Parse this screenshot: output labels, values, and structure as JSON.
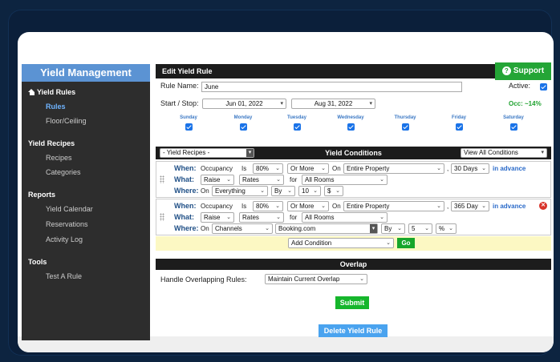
{
  "sidebar": {
    "title": "Yield Management",
    "sections": [
      {
        "title": "Yield Rules",
        "items": [
          {
            "label": "Rules",
            "active": true
          },
          {
            "label": "Floor/Ceiling"
          }
        ]
      },
      {
        "title": "Yield Recipes",
        "items": [
          {
            "label": "Recipes"
          },
          {
            "label": "Categories"
          }
        ]
      },
      {
        "title": "Reports",
        "items": [
          {
            "label": "Yield Calendar"
          },
          {
            "label": "Reservations"
          },
          {
            "label": "Activity Log"
          }
        ]
      },
      {
        "title": "Tools",
        "items": [
          {
            "label": "Test A Rule"
          }
        ]
      }
    ]
  },
  "header": {
    "title": "Edit Yield Rule",
    "support_label": "Support"
  },
  "form": {
    "rule_name_label": "Rule Name:",
    "rule_name_value": "June",
    "active_label": "Active:",
    "start_stop_label": "Start / Stop:",
    "start_date": "Jun 01, 2022",
    "end_date": "Aug 31, 2022",
    "occ": "Occ: ~14%",
    "days": [
      "Sunday",
      "Monday",
      "Tuesday",
      "Wednesday",
      "Thursday",
      "Friday",
      "Saturday"
    ]
  },
  "conditions": {
    "recipes_select": "- Yield Recipes -",
    "title": "Yield Conditions",
    "view_select": "View All Conditions",
    "rules": [
      {
        "when_label": "When:",
        "what_label": "What:",
        "where_label": "Where:",
        "occupancy": "Occupancy",
        "is": "Is",
        "pct": "80%",
        "or_more": "Or More",
        "on": "On",
        "property": "Entire Property",
        "days": "30 Days",
        "advance": "in advance",
        "action": "Raise",
        "target": "Rates",
        "for": "for",
        "rooms": "All Rooms",
        "where_on": "On",
        "where_what": "Everything",
        "by": "By",
        "amount": "10",
        "unit": "$"
      },
      {
        "when_label": "When:",
        "what_label": "What:",
        "where_label": "Where:",
        "occupancy": "Occupancy",
        "is": "Is",
        "pct": "80%",
        "or_more": "Or More",
        "on": "On",
        "property": "Entire Property",
        "days": "365 Day",
        "advance": "in advance",
        "action": "Raise",
        "target": "Rates",
        "for": "for",
        "rooms": "All Rooms",
        "where_on": "On",
        "where_what": "Channels",
        "channel": "Booking.com",
        "by": "By",
        "amount": "5",
        "unit": "%"
      }
    ],
    "add_condition": "Add Condition",
    "go_label": "Go"
  },
  "overlap": {
    "title": "Overlap",
    "handle_label": "Handle Overlapping Rules:",
    "handle_value": "Maintain Current Overlap"
  },
  "actions": {
    "submit": "Submit",
    "delete": "Delete Yield Rule"
  }
}
